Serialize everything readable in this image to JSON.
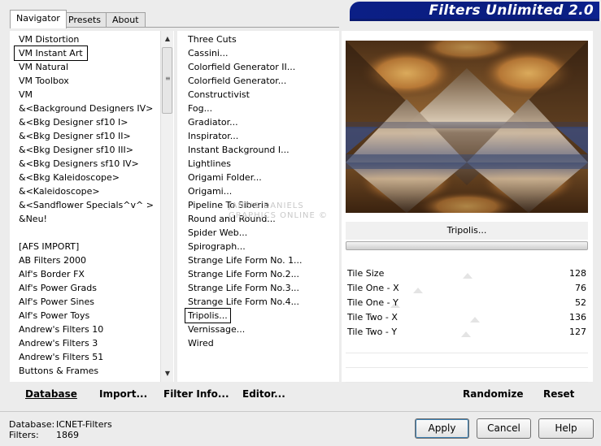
{
  "window": {
    "title": "Filters Unlimited 2.0"
  },
  "tabs": [
    {
      "label": "Navigator",
      "active": true
    },
    {
      "label": "Presets",
      "active": false
    },
    {
      "label": "About",
      "active": false
    }
  ],
  "categories": [
    {
      "label": "VM Distortion"
    },
    {
      "label": "VM Instant Art",
      "selected": true
    },
    {
      "label": "VM Natural"
    },
    {
      "label": "VM Toolbox"
    },
    {
      "label": "VM"
    },
    {
      "label": "&<Background Designers IV>"
    },
    {
      "label": "&<Bkg Designer sf10 I>"
    },
    {
      "label": "&<Bkg Designer sf10 II>"
    },
    {
      "label": "&<Bkg Designer sf10 III>"
    },
    {
      "label": "&<Bkg Designers sf10 IV>"
    },
    {
      "label": "&<Bkg Kaleidoscope>"
    },
    {
      "label": "&<Kaleidoscope>"
    },
    {
      "label": "&<Sandflower Specials^v^ >"
    },
    {
      "label": "&Neu!"
    },
    {
      "label": ""
    },
    {
      "label": "[AFS IMPORT]"
    },
    {
      "label": "AB Filters 2000"
    },
    {
      "label": "Alf's Border FX"
    },
    {
      "label": "Alf's Power Grads"
    },
    {
      "label": "Alf's Power Sines"
    },
    {
      "label": "Alf's Power Toys"
    },
    {
      "label": "Andrew's Filters 10"
    },
    {
      "label": "Andrew's Filters 3"
    },
    {
      "label": "Andrew's Filters 51"
    },
    {
      "label": "Buttons & Frames"
    }
  ],
  "filters": [
    {
      "label": "Three Cuts"
    },
    {
      "label": "Cassini..."
    },
    {
      "label": "Colorfield Generator II..."
    },
    {
      "label": "Colorfield Generator..."
    },
    {
      "label": "Constructivist"
    },
    {
      "label": "Fog..."
    },
    {
      "label": "Gradiator..."
    },
    {
      "label": "Inspirator..."
    },
    {
      "label": "Instant Background I..."
    },
    {
      "label": "Lightlines"
    },
    {
      "label": "Origami Folder..."
    },
    {
      "label": "Origami..."
    },
    {
      "label": "Pipeline To Siberia"
    },
    {
      "label": "Round and Round..."
    },
    {
      "label": "Spider Web..."
    },
    {
      "label": "Spirograph..."
    },
    {
      "label": "Strange Life Form No. 1..."
    },
    {
      "label": "Strange Life Form No.2..."
    },
    {
      "label": "Strange Life Form No.3..."
    },
    {
      "label": "Strange Life Form No.4..."
    },
    {
      "label": "Tripolis...",
      "selected": true
    },
    {
      "label": "Vernissage..."
    },
    {
      "label": "Wired"
    }
  ],
  "preview": {
    "filter_name": "Tripolis..."
  },
  "params": [
    {
      "label": "Tile Size",
      "value": "128",
      "fraction": 0.502
    },
    {
      "label": "Tile One - X",
      "value": "76",
      "fraction": 0.298
    },
    {
      "label": "Tile One - Y",
      "value": "52",
      "fraction": 0.204
    },
    {
      "label": "Tile Two - X",
      "value": "136",
      "fraction": 0.533
    },
    {
      "label": "Tile Two - Y",
      "value": "127",
      "fraction": 0.498
    }
  ],
  "toolbar": {
    "database_label": "Database",
    "import_label": "Import...",
    "filter_info_label": "Filter Info...",
    "editor_label": "Editor...",
    "randomize_label": "Randomize",
    "reset_label": "Reset"
  },
  "footer": {
    "database_label": "Database:",
    "database_value": "ICNET-Filters",
    "filters_label": "Filters:",
    "filters_value": "1869"
  },
  "buttons": {
    "apply_label": "Apply",
    "cancel_label": "Cancel",
    "help_label": "Help"
  },
  "watermark": {
    "line1": "JANE'S DANIELS",
    "line2": "GRAPHICS ONLINE ©"
  }
}
